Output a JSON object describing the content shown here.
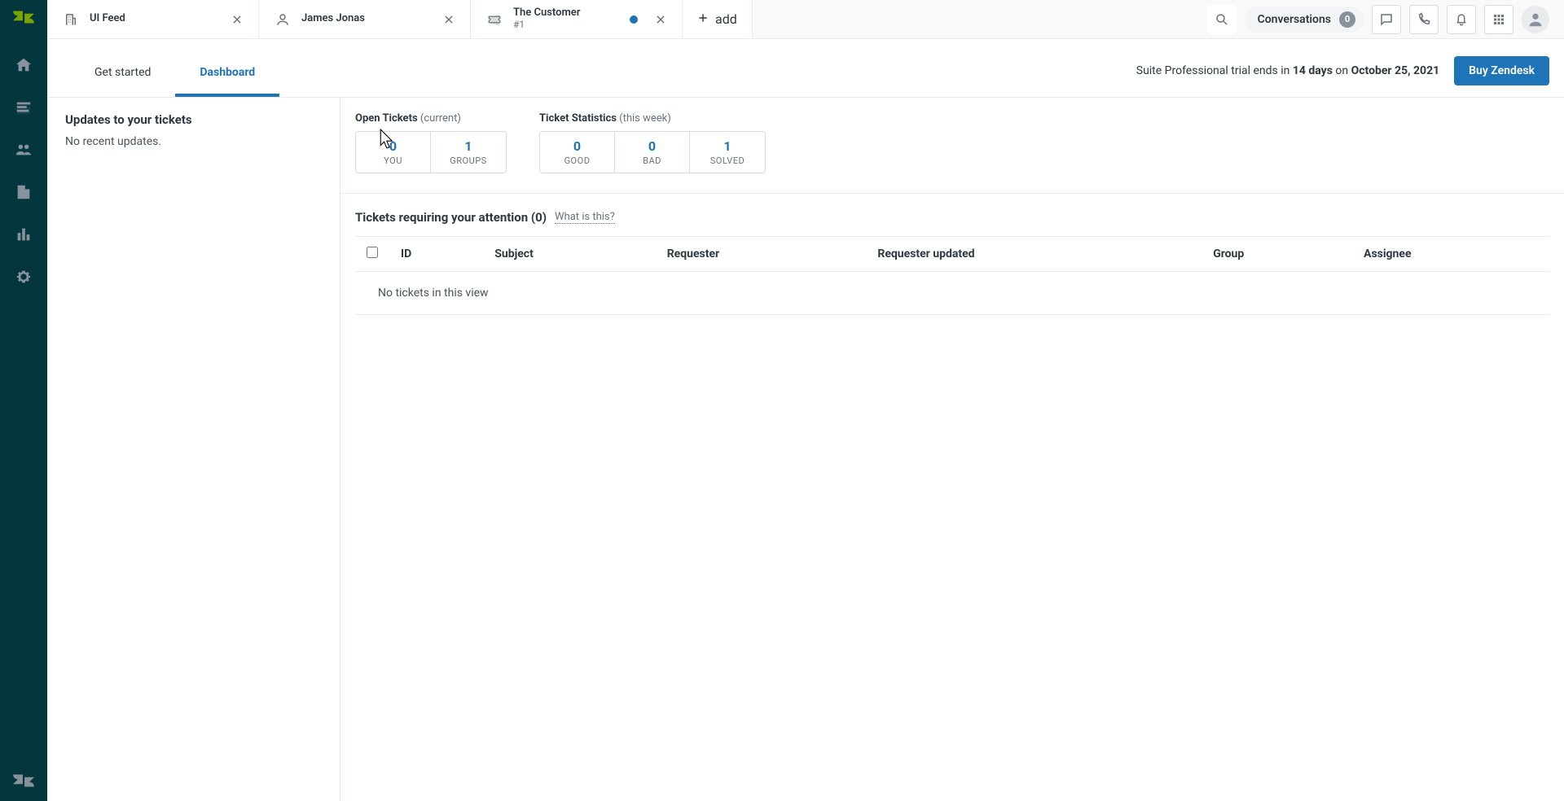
{
  "colors": {
    "sidebar": "#03363d",
    "accent": "#1f73b7"
  },
  "tabs": [
    {
      "icon": "building",
      "title": "UI Feed",
      "sub": ""
    },
    {
      "icon": "user",
      "title": "James Jonas",
      "sub": ""
    },
    {
      "icon": "ticket",
      "title": "The Customer",
      "sub": "#1",
      "dot_color": "#1f73b7"
    }
  ],
  "add_tab_label": "add",
  "header": {
    "conversations_label": "Conversations",
    "conversations_count": "0"
  },
  "trial_banner": {
    "prefix": "Suite Professional trial ends in ",
    "days": "14 days",
    "mid": " on ",
    "date": "October 25, 2021",
    "buy_label": "Buy Zendesk"
  },
  "page_tabs": [
    {
      "label": "Get started",
      "active": false
    },
    {
      "label": "Dashboard",
      "active": true
    }
  ],
  "updates": {
    "title": "Updates to your tickets",
    "empty": "No recent updates."
  },
  "open_tickets": {
    "title": "Open Tickets",
    "suffix": "(current)",
    "cells": [
      {
        "val": "0",
        "lbl": "YOU"
      },
      {
        "val": "1",
        "lbl": "GROUPS"
      }
    ]
  },
  "ticket_stats": {
    "title": "Ticket Statistics",
    "suffix": "(this week)",
    "cells": [
      {
        "val": "0",
        "lbl": "GOOD"
      },
      {
        "val": "0",
        "lbl": "BAD"
      },
      {
        "val": "1",
        "lbl": "SOLVED"
      }
    ]
  },
  "attention": {
    "title": "Tickets requiring your attention (0)",
    "hint": "What is this?",
    "columns": [
      "ID",
      "Subject",
      "Requester",
      "Requester updated",
      "Group",
      "Assignee"
    ],
    "empty_row": "No tickets in this view"
  }
}
